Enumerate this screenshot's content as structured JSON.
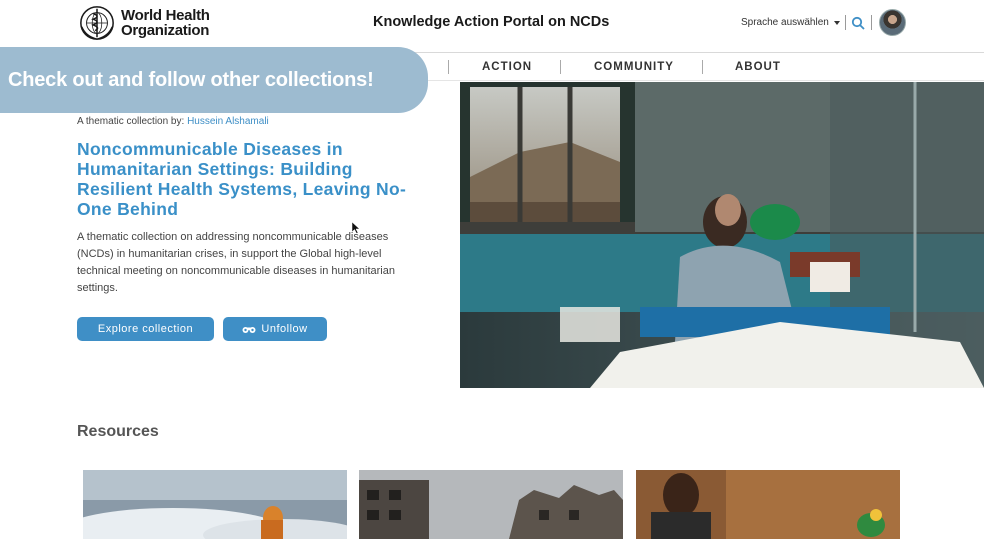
{
  "header": {
    "logo_line1": "World Health",
    "logo_line2": "Organization",
    "portal_title": "Knowledge Action Portal on NCDs",
    "language_label": "Sprache auswählen",
    "search_icon": "search-icon",
    "avatar_icon": "user-avatar"
  },
  "nav": {
    "items": [
      {
        "label": "ACTION"
      },
      {
        "label": "COMMUNITY"
      },
      {
        "label": "ABOUT"
      }
    ]
  },
  "banner": {
    "text": "Check out and follow other collections!",
    "color": "#9dbbd0"
  },
  "collection": {
    "byline_prefix": "A thematic collection by:",
    "author": "Hussein Alshamali",
    "title": "Noncommunicable Diseases in Humanitarian Settings: Building Resilient Health Systems, Leaving No-One Behind",
    "description": "A thematic collection on addressing noncommunicable diseases (NCDs) in humanitarian crises, in support the Global high-level technical meeting on noncommunicable diseases in humanitarian settings.",
    "explore_label": "Explore collection",
    "unfollow_label": "Unfollow",
    "unfollow_icon": "binoculars-icon",
    "accent": "#3f8fc6"
  },
  "resources": {
    "title": "Resources",
    "cards": [
      {
        "image": "flood-relief-photo"
      },
      {
        "image": "damaged-buildings-photo"
      },
      {
        "image": "community-health-photo"
      }
    ]
  }
}
